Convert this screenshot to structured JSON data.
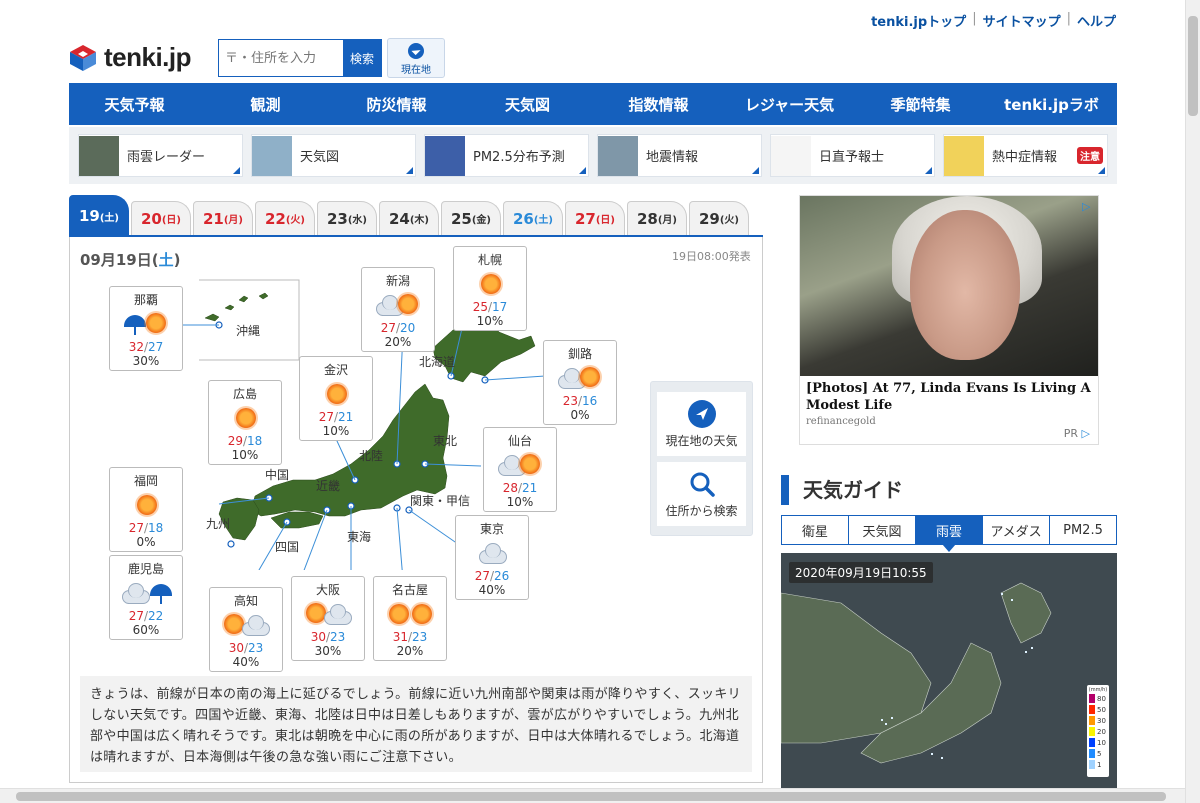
{
  "toplinks": {
    "top": "tenki.jpトップ",
    "sitemap": "サイトマップ",
    "help": "ヘルプ",
    "sep": "|"
  },
  "logo": {
    "text": "tenki.jp"
  },
  "search": {
    "placeholder": "〒・住所を入力",
    "button": "検索"
  },
  "curloc": {
    "label": "現在地"
  },
  "mainnav": [
    "天気予報",
    "観測",
    "防災情報",
    "天気図",
    "指数情報",
    "レジャー天気",
    "季節特集",
    "tenki.jpラボ"
  ],
  "subnav": [
    {
      "label": "雨雲レーダー",
      "icon": "rain-radar-thumbnail"
    },
    {
      "label": "天気図",
      "icon": "weather-map-thumbnail"
    },
    {
      "label": "PM2.5分布予測",
      "icon": "pm25-thumbnail"
    },
    {
      "label": "地震情報",
      "icon": "earthquake-thumbnail"
    },
    {
      "label": "日直予報士",
      "icon": "forecaster-thumbnail"
    },
    {
      "label": "熱中症情報",
      "icon": "heatstroke-thumbnail",
      "badge": "注意"
    }
  ],
  "tabs": [
    {
      "day": "19",
      "dow": "(土)",
      "kind": "active"
    },
    {
      "day": "20",
      "dow": "(日)",
      "kind": "sun"
    },
    {
      "day": "21",
      "dow": "(月)",
      "kind": "sun"
    },
    {
      "day": "22",
      "dow": "(火)",
      "kind": "sun"
    },
    {
      "day": "23",
      "dow": "(水)",
      "kind": "wk"
    },
    {
      "day": "24",
      "dow": "(木)",
      "kind": "wk"
    },
    {
      "day": "25",
      "dow": "(金)",
      "kind": "wk"
    },
    {
      "day": "26",
      "dow": "(土)",
      "kind": "sat"
    },
    {
      "day": "27",
      "dow": "(日)",
      "kind": "sun"
    },
    {
      "day": "28",
      "dow": "(月)",
      "kind": "wk"
    },
    {
      "day": "29",
      "dow": "(火)",
      "kind": "wk"
    }
  ],
  "panel": {
    "date_pre": "09月19日(",
    "date_dow": "土",
    "date_post": ")",
    "issued": "19日08:00発表"
  },
  "cities": {
    "naha": {
      "name": "那覇",
      "hi": "32",
      "lo": "27",
      "pop": "30%",
      "wx": "rain-sun"
    },
    "hiroshima": {
      "name": "広島",
      "hi": "29",
      "lo": "18",
      "pop": "10%",
      "wx": "sun"
    },
    "kanazawa": {
      "name": "金沢",
      "hi": "27",
      "lo": "21",
      "pop": "10%",
      "wx": "sun"
    },
    "niigata": {
      "name": "新潟",
      "hi": "27",
      "lo": "20",
      "pop": "20%",
      "wx": "cloud-sun"
    },
    "sapporo": {
      "name": "札幌",
      "hi": "25",
      "lo": "17",
      "pop": "10%",
      "wx": "sun"
    },
    "kushiro": {
      "name": "釧路",
      "hi": "23",
      "lo": "16",
      "pop": "0%",
      "wx": "cloud-sun"
    },
    "sendai": {
      "name": "仙台",
      "hi": "28",
      "lo": "21",
      "pop": "10%",
      "wx": "cloud-sun"
    },
    "fukuoka": {
      "name": "福岡",
      "hi": "27",
      "lo": "18",
      "pop": "0%",
      "wx": "sun"
    },
    "kagoshima": {
      "name": "鹿児島",
      "hi": "27",
      "lo": "22",
      "pop": "60%",
      "wx": "cloud-rain"
    },
    "kochi": {
      "name": "高知",
      "hi": "30",
      "lo": "23",
      "pop": "40%",
      "wx": "sun-cloud"
    },
    "osaka": {
      "name": "大阪",
      "hi": "30",
      "lo": "23",
      "pop": "30%",
      "wx": "sun-cloud"
    },
    "nagoya": {
      "name": "名古屋",
      "hi": "31",
      "lo": "23",
      "pop": "20%",
      "wx": "sun-sun"
    },
    "tokyo": {
      "name": "東京",
      "hi": "27",
      "lo": "26",
      "pop": "40%",
      "wx": "cloud"
    }
  },
  "regions": {
    "okinawa": "沖縄",
    "hokkaido": "北海道",
    "tohoku": "東北",
    "hokuriku": "北陸",
    "chugoku": "中国",
    "kinki": "近畿",
    "kyushu": "九州",
    "shikoku": "四国",
    "tokai": "東海",
    "kanto": "関東・甲信"
  },
  "sidebtns": {
    "current": "現在地の天気",
    "search": "住所から検索"
  },
  "comment": "きょうは、前線が日本の南の海上に延びるでしょう。前線に近い九州南部や関東は雨が降りやすく、スッキリしない天気です。四国や近畿、東海、北陸は日中は日差しもありますが、雲が広がりやすいでしょう。九州北部や中国は広く晴れそうです。東北は朝晩を中心に雨の所がありますが、日中は大体晴れるでしょう。北海道は晴れますが、日本海側は午後の急な強い雨にご注意下さい。",
  "ad": {
    "title": "[Photos] At 77, Linda Evans Is Living A Modest Life",
    "source": "refinancegold",
    "pr": "PR"
  },
  "guide": {
    "title": "天気ガイド",
    "tabs": [
      "衛星",
      "天気図",
      "雨雲",
      "アメダス",
      "PM2.5"
    ],
    "active": 2,
    "timestamp": "2020年09月19日10:55",
    "legend_unit": "(mm/h)",
    "legend": [
      "80",
      "50",
      "30",
      "20",
      "10",
      "5",
      "1"
    ]
  },
  "colors": {
    "brand": "#1560bd",
    "hot": "#d8262d",
    "cold": "#2a8ad8"
  }
}
